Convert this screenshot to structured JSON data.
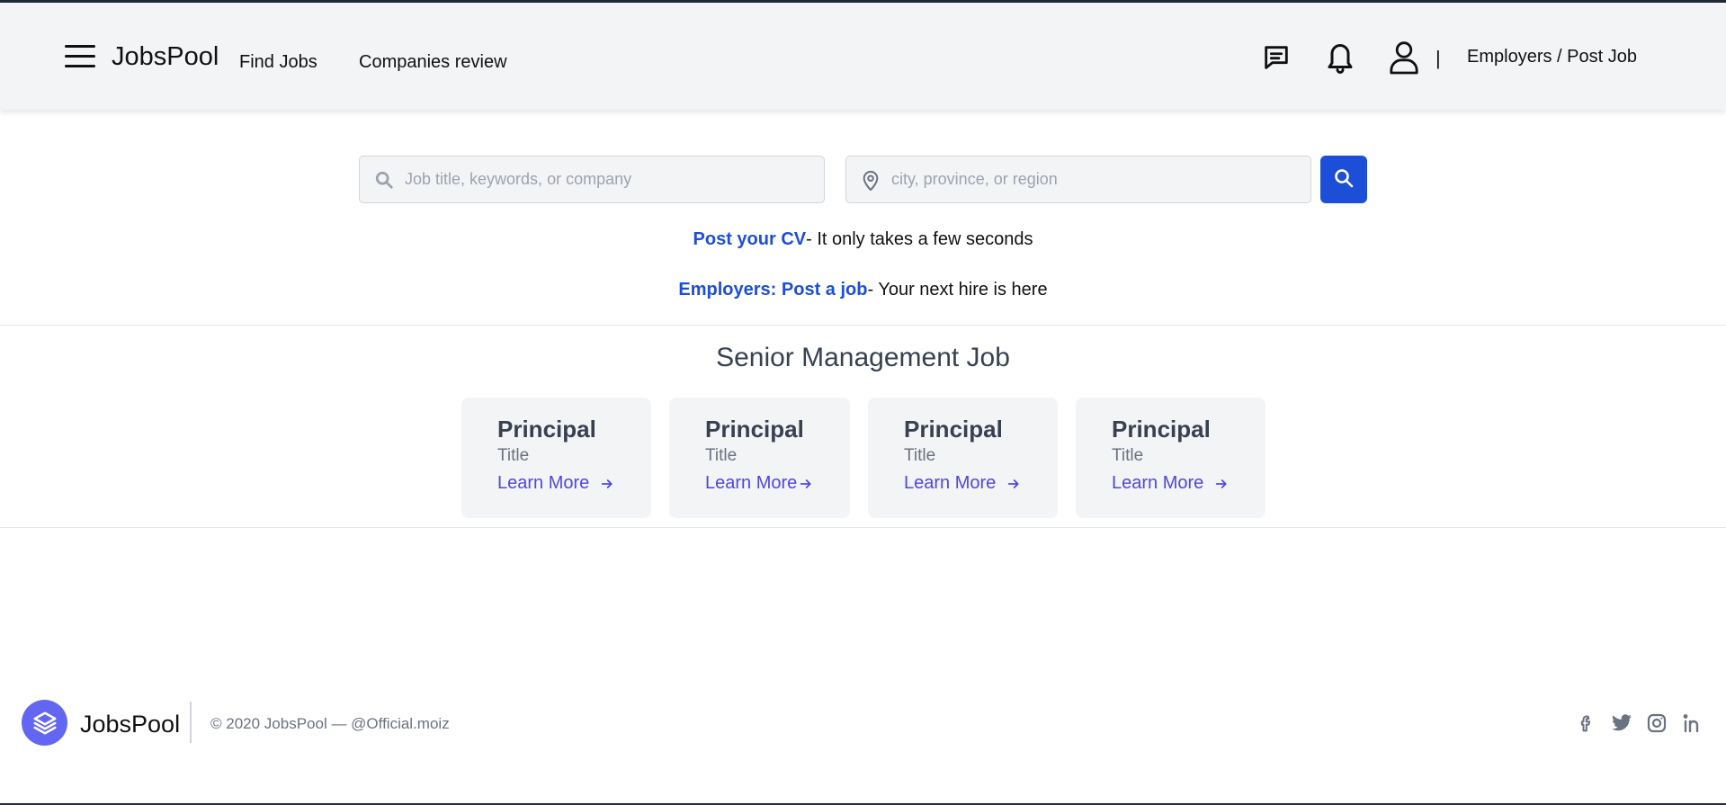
{
  "header": {
    "brand": "JobsPool",
    "nav": {
      "find_jobs": "Find Jobs",
      "companies_review": "Companies review"
    },
    "separator": "|",
    "employers_link": "Employers / Post Job",
    "icons": [
      "menu-icon",
      "chat-icon",
      "bell-icon",
      "user-icon"
    ]
  },
  "search": {
    "what_placeholder": "Job title, keywords, or company",
    "where_placeholder": "city, province, or region",
    "what_value": "",
    "where_value": ""
  },
  "promos": {
    "cv_link": "Post your CV",
    "cv_text": "- It only takes a few seconds",
    "employer_link": "Employers: Post a job",
    "employer_text": "- Your next hire is here"
  },
  "section": {
    "title": "Senior Management Job",
    "cards": [
      {
        "title": "Principal",
        "subtitle": "Title",
        "link": "Learn More"
      },
      {
        "title": "Principal",
        "subtitle": "Title",
        "link": "Learn More"
      },
      {
        "title": "Principal",
        "subtitle": "Title",
        "link": "Learn More"
      },
      {
        "title": "Principal",
        "subtitle": "Title",
        "link": "Learn More"
      }
    ]
  },
  "footer": {
    "brand": "JobsPool",
    "copyright": "© 2020 JobsPool — @Official.moiz",
    "social": [
      "facebook-icon",
      "twitter-icon",
      "instagram-icon",
      "linkedin-icon"
    ]
  },
  "colors": {
    "accent_blue": "#1d4ed8",
    "indigo": "#4f46e5",
    "logo_indigo": "#6366f1",
    "header_bg": "#f3f4f6"
  }
}
